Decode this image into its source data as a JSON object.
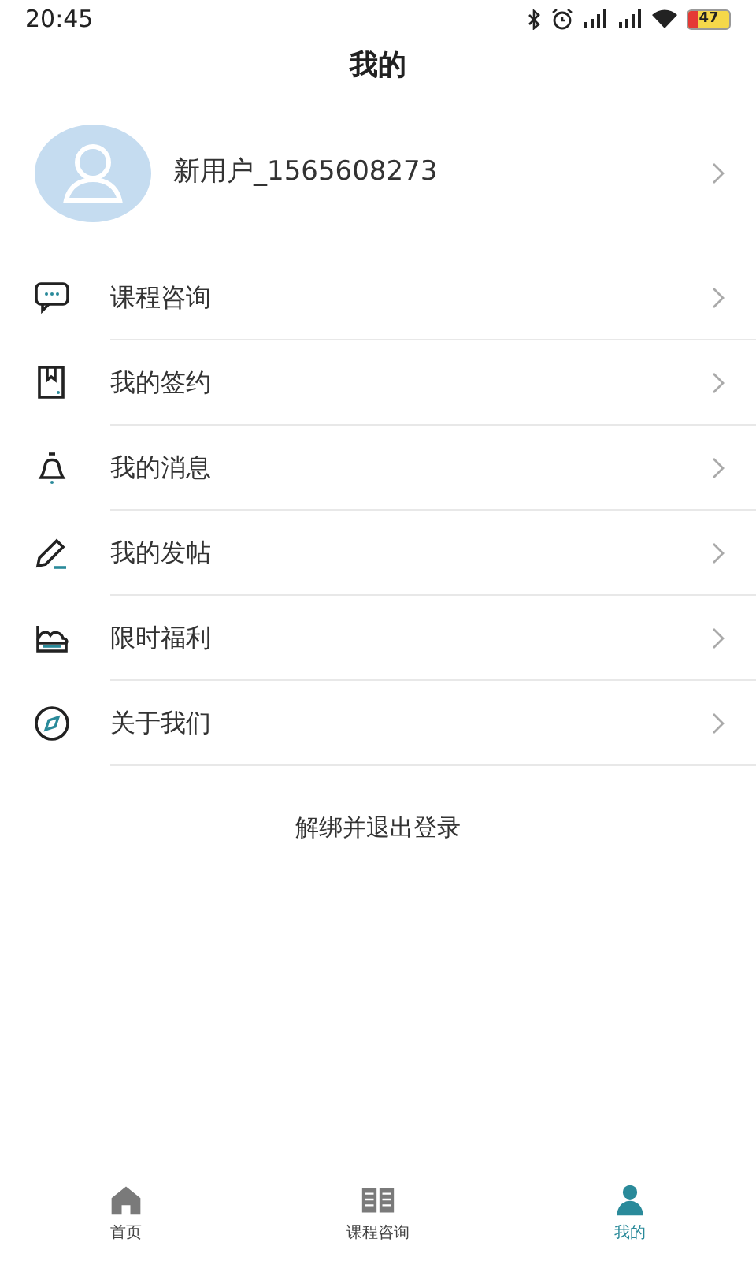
{
  "status_bar": {
    "time": "20:45",
    "battery": "47"
  },
  "title": "我的",
  "profile": {
    "username": "新用户_1565608273"
  },
  "menu": [
    {
      "kind": "chat",
      "label": "课程咨询"
    },
    {
      "kind": "book",
      "label": "我的签约"
    },
    {
      "kind": "bell",
      "label": "我的消息"
    },
    {
      "kind": "pen",
      "label": "我的发帖"
    },
    {
      "kind": "gift",
      "label": "限时福利"
    },
    {
      "kind": "compass",
      "label": "关于我们"
    }
  ],
  "logout": "解绑并退出登录",
  "tabs": [
    {
      "kind": "home",
      "label": "首页",
      "selected": false
    },
    {
      "kind": "book",
      "label": "课程咨询",
      "selected": false
    },
    {
      "kind": "person",
      "label": "我的",
      "selected": true
    }
  ]
}
